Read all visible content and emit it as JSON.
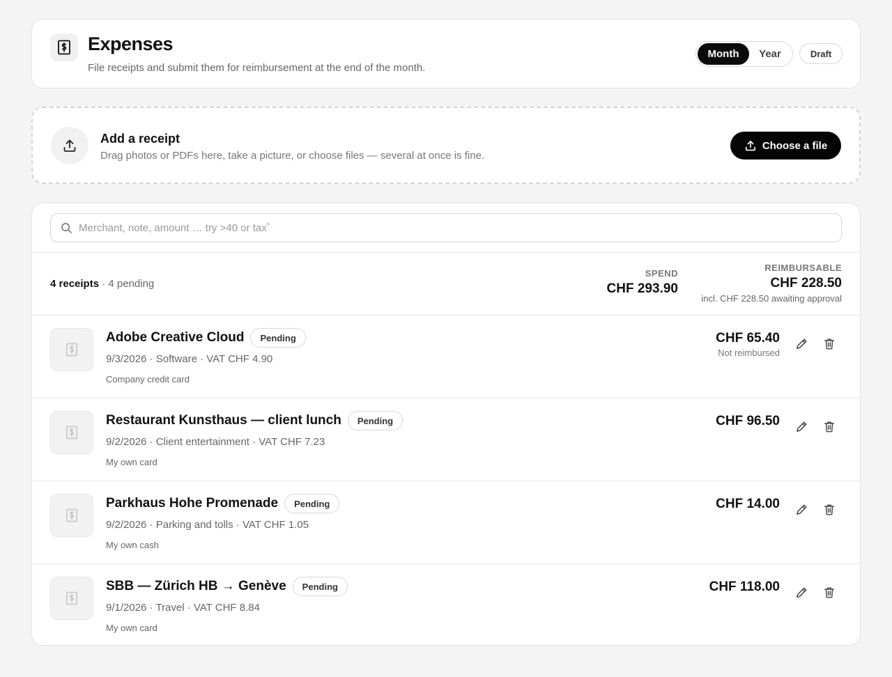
{
  "header": {
    "title": "Expenses",
    "subtitle": "File receipts and submit them for reimbursement at the end of the month.",
    "period_options": [
      "Month",
      "Year"
    ],
    "period_selected": "Month",
    "draft_label": "Draft"
  },
  "upload": {
    "title": "Add a receipt",
    "description": "Drag photos or PDFs here, take a picture, or choose files — several at once is fine.",
    "button_label": "Choose a file"
  },
  "search": {
    "placeholder": "Merchant, note, amount … try >40 or tax˚"
  },
  "summary": {
    "count_label": "4 receipts",
    "pending_label": "· 4 pending",
    "spend_label": "SPEND",
    "spend_value": "CHF 293.90",
    "reimbursable_label": "REIMBURSABLE",
    "reimbursable_value": "CHF 228.50",
    "reimbursable_note": "incl. CHF 228.50 awaiting approval"
  },
  "receipts": [
    {
      "title": "Adobe Creative Cloud",
      "status": "Pending",
      "meta": "9/3/2026 · Software · VAT CHF 4.90",
      "payment": "Company credit card",
      "amount": "CHF 65.40",
      "amount_note": "Not reimbursed"
    },
    {
      "title": "Restaurant Kunsthaus — client lunch",
      "status": "Pending",
      "meta": "9/2/2026 · Client entertainment · VAT CHF 7.23",
      "payment": "My own card",
      "amount": "CHF 96.50",
      "amount_note": ""
    },
    {
      "title": "Parkhaus Hohe Promenade",
      "status": "Pending",
      "meta": "9/2/2026 · Parking and tolls · VAT CHF 1.05",
      "payment": "My own cash",
      "amount": "CHF 14.00",
      "amount_note": ""
    },
    {
      "title": "SBB — Zürich HB → Genève",
      "status": "Pending",
      "meta": "9/1/2026 · Travel · VAT CHF 8.84",
      "payment": "My own card",
      "amount": "CHF 118.00",
      "amount_note": ""
    }
  ],
  "icons": {
    "app": "receipt-dollar-icon",
    "upload": "upload-icon",
    "search": "search-icon",
    "thumb": "receipt-placeholder-icon",
    "edit": "pencil-icon",
    "delete": "trash-icon"
  },
  "colors": {
    "accent": "#0b0b0b",
    "background": "#f4f4f4",
    "muted_text": "#666666"
  }
}
